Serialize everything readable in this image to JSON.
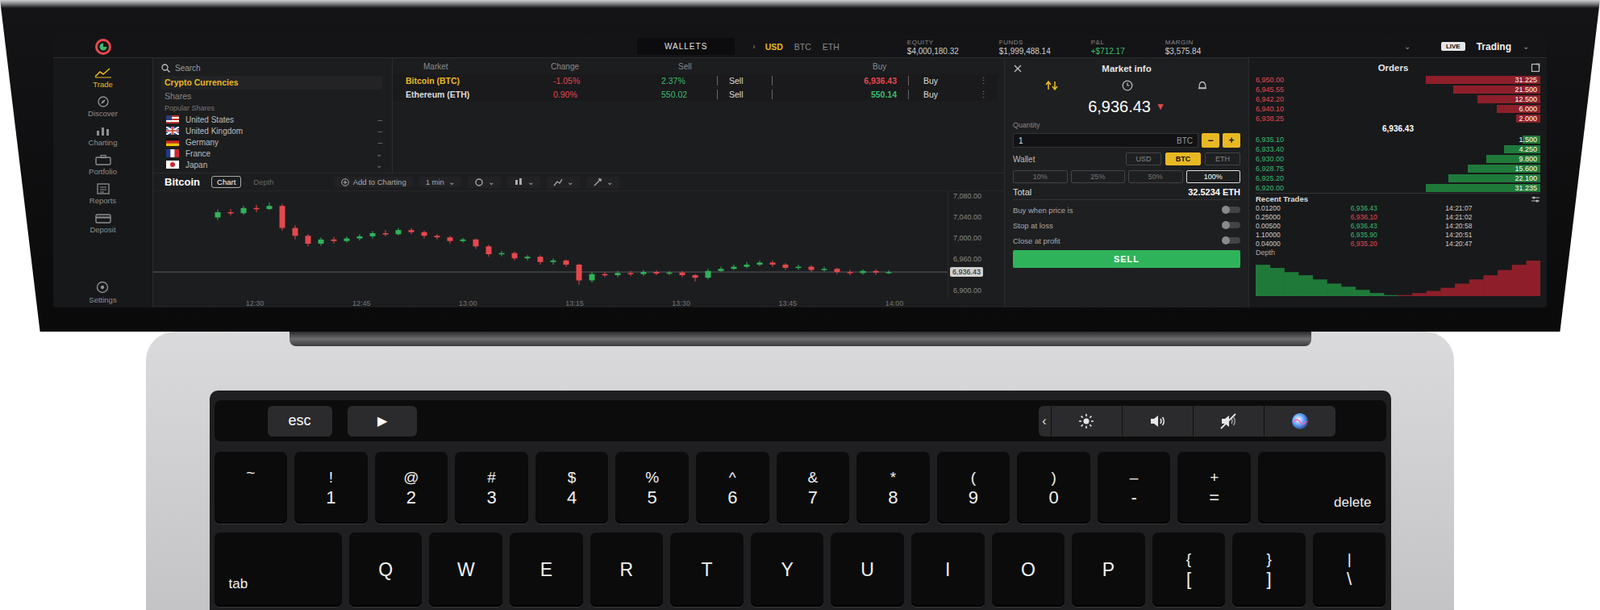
{
  "top_bar": {
    "wallets": "WALLETS",
    "separator": "›",
    "currencies": [
      {
        "label": "USD",
        "selected": true
      },
      {
        "label": "BTC",
        "selected": false
      },
      {
        "label": "ETH",
        "selected": false
      }
    ],
    "stats": [
      {
        "label": "EQUITY",
        "value": "$4,000,180.32",
        "color": "#cfcfcf"
      },
      {
        "label": "FUNDS",
        "value": "$1,999,488.14",
        "color": "#cfcfcf"
      },
      {
        "label": "P&L",
        "value": "+$712.17",
        "color": "#3dbb6b"
      },
      {
        "label": "MARGIN",
        "value": "$3,575.84",
        "color": "#cfcfcf"
      }
    ],
    "stats_caret": "⌄",
    "mode_badge": "LIVE",
    "mode": "Trading",
    "mode_caret": "⌄"
  },
  "sidebar": {
    "items": [
      {
        "label": "Trade",
        "selected": true
      },
      {
        "label": "Discover",
        "selected": false
      },
      {
        "label": "Charting",
        "selected": false
      },
      {
        "label": "Portfolio",
        "selected": false
      },
      {
        "label": "Reports",
        "selected": false
      },
      {
        "label": "Deposit",
        "selected": false
      }
    ],
    "footer": "Settings"
  },
  "markets": {
    "search": {
      "placeholder": "Search"
    },
    "columns": [
      "Market",
      "Change",
      "Sell",
      "Buy"
    ],
    "categories": [
      {
        "label": "Crypto Currencies",
        "selected": true
      },
      {
        "label": "Shares",
        "selected": false
      }
    ],
    "group": "Popular Shares",
    "countries": [
      {
        "name": "United States",
        "mark": "–"
      },
      {
        "name": "United Kingdom",
        "mark": "–"
      },
      {
        "name": "Germany",
        "mark": "–"
      },
      {
        "name": "France",
        "mark": "⌄"
      },
      {
        "name": "Japan",
        "mark": "⌄"
      }
    ],
    "rows": [
      {
        "name": "Bitcoin (BTC)",
        "selected": true,
        "change": "-1.05%",
        "change_color": "#e5484d",
        "spread": "2.37%",
        "spread_color": "#3dbb6b",
        "sell": "Sell",
        "price": "6,936.43",
        "price_color": "#e5484d",
        "buy": "Buy",
        "more": "⋮"
      },
      {
        "name": "Ethereum (ETH)",
        "selected": false,
        "change": "0.90%",
        "change_color": "#e5484d",
        "spread": "550.02",
        "spread_color": "#3dbb6b",
        "sell": "Sell",
        "price": "550.14",
        "price_color": "#3dbb6b",
        "buy": "Buy",
        "more": "⋮"
      }
    ]
  },
  "chart": {
    "title": "Bitcoin",
    "views": [
      {
        "label": "Chart",
        "selected": true
      },
      {
        "label": "Depth",
        "selected": false
      }
    ],
    "add": "Add to Charting",
    "interval": "1 min",
    "caret": "⌄",
    "y_ticks": [
      {
        "label": "7,080.00",
        "value": 7080
      },
      {
        "label": "7,040.00",
        "value": 7040
      },
      {
        "label": "7,000.00",
        "value": 7000
      },
      {
        "label": "6,960.00",
        "value": 6960
      },
      {
        "label": "6,900.00",
        "value": 6900
      }
    ],
    "x_ticks": [
      "12:30",
      "12:45",
      "13:00",
      "13:15",
      "13:30",
      "13:45",
      "14:00"
    ],
    "last": "6,936.43",
    "candles": [
      [
        7040,
        7050,
        7055,
        7035
      ],
      [
        7050,
        7048,
        7056,
        7044
      ],
      [
        7048,
        7058,
        7062,
        7045
      ],
      [
        7058,
        7056,
        7064,
        7050
      ],
      [
        7056,
        7062,
        7068,
        7054
      ],
      [
        7062,
        7020,
        7066,
        7015
      ],
      [
        7020,
        7005,
        7025,
        6998
      ],
      [
        7005,
        6990,
        7008,
        6985
      ],
      [
        6990,
        6998,
        7002,
        6986
      ],
      [
        6998,
        6995,
        7003,
        6990
      ],
      [
        6995,
        7000,
        7004,
        6992
      ],
      [
        7000,
        7004,
        7008,
        6996
      ],
      [
        7004,
        7010,
        7014,
        7000
      ],
      [
        7010,
        7008,
        7016,
        7004
      ],
      [
        7008,
        7016,
        7020,
        7006
      ],
      [
        7016,
        7012,
        7020,
        7008
      ],
      [
        7012,
        7005,
        7015,
        7000
      ],
      [
        7005,
        7002,
        7008,
        6998
      ],
      [
        7002,
        6995,
        7005,
        6990
      ],
      [
        6995,
        6998,
        7001,
        6992
      ],
      [
        6998,
        6985,
        7000,
        6980
      ],
      [
        6985,
        6970,
        6988,
        6965
      ],
      [
        6970,
        6972,
        6976,
        6966
      ],
      [
        6972,
        6962,
        6975,
        6958
      ],
      [
        6962,
        6965,
        6968,
        6958
      ],
      [
        6965,
        6955,
        6968,
        6950
      ],
      [
        6955,
        6958,
        6962,
        6950
      ],
      [
        6958,
        6950,
        6960,
        6946
      ],
      [
        6950,
        6920,
        6952,
        6912
      ],
      [
        6920,
        6932,
        6936,
        6916
      ],
      [
        6932,
        6930,
        6936,
        6926
      ],
      [
        6930,
        6934,
        6938,
        6926
      ],
      [
        6934,
        6932,
        6938,
        6928
      ],
      [
        6932,
        6936,
        6940,
        6928
      ],
      [
        6936,
        6933,
        6939,
        6930
      ],
      [
        6933,
        6935,
        6938,
        6930
      ],
      [
        6935,
        6930,
        6938,
        6926
      ],
      [
        6930,
        6925,
        6932,
        6918
      ],
      [
        6925,
        6938,
        6942,
        6922
      ],
      [
        6938,
        6942,
        6946,
        6936
      ],
      [
        6942,
        6946,
        6950,
        6940
      ],
      [
        6946,
        6950,
        6955,
        6943
      ],
      [
        6950,
        6954,
        6958,
        6947
      ],
      [
        6954,
        6950,
        6958,
        6946
      ],
      [
        6950,
        6944,
        6953,
        6940
      ],
      [
        6944,
        6946,
        6950,
        6940
      ],
      [
        6946,
        6940,
        6949,
        6936
      ],
      [
        6940,
        6942,
        6946,
        6937
      ],
      [
        6942,
        6936,
        6944,
        6932
      ],
      [
        6936,
        6934,
        6940,
        6930
      ],
      [
        6934,
        6938,
        6941,
        6931
      ],
      [
        6938,
        6935,
        6941,
        6931
      ],
      [
        6935,
        6936,
        6939,
        6932
      ]
    ]
  },
  "market_info": {
    "title": "Market info",
    "price": "6,936.43",
    "price_arrow": "▼",
    "quantity_label": "Quantity",
    "quantity": "1",
    "unit": "BTC",
    "minus": "−",
    "plus": "+",
    "wallet_label": "Wallet",
    "wallets": [
      {
        "label": "USD",
        "selected": false
      },
      {
        "label": "BTC",
        "selected": true
      },
      {
        "label": "ETH",
        "selected": false
      }
    ],
    "percents": [
      {
        "label": "10%",
        "selected": false
      },
      {
        "label": "25%",
        "selected": false
      },
      {
        "label": "50%",
        "selected": false
      },
      {
        "label": "100%",
        "selected": true
      }
    ],
    "total_label": "Total",
    "total": "32.5234 ETH",
    "options": [
      {
        "label": "Buy when price is",
        "on": false
      },
      {
        "label": "Stop at loss",
        "on": false
      },
      {
        "label": "Close at profit",
        "on": false
      }
    ],
    "action": "SELL"
  },
  "orders": {
    "title": "Orders",
    "asks": [
      {
        "price": "6,950.00",
        "amount": "31.225",
        "level": 0.95
      },
      {
        "price": "6,945.55",
        "amount": "21.500",
        "level": 0.72
      },
      {
        "price": "6,942.20",
        "amount": "12.500",
        "level": 0.52
      },
      {
        "price": "6,940.10",
        "amount": "6.000",
        "level": 0.36
      },
      {
        "price": "6,938.25",
        "amount": "2.000",
        "level": 0.2
      }
    ],
    "mid": "6,936.43",
    "bids": [
      {
        "price": "6,935.10",
        "amount": "1.500",
        "level": 0.15
      },
      {
        "price": "6,933.40",
        "amount": "4.250",
        "level": 0.3
      },
      {
        "price": "6,930.00",
        "amount": "9.800",
        "level": 0.45
      },
      {
        "price": "6,928.75",
        "amount": "15.600",
        "level": 0.6
      },
      {
        "price": "6,925.20",
        "amount": "22.100",
        "level": 0.76
      },
      {
        "price": "6,920.00",
        "amount": "31.235",
        "level": 0.95
      }
    ],
    "recent_title": "Recent Trades",
    "trades": [
      {
        "amount": "0.01200",
        "price": "6,936.43",
        "time": "14:21:07",
        "color": "#3dbb6b"
      },
      {
        "amount": "0.25000",
        "price": "6,936.10",
        "time": "14:21:02",
        "color": "#e5484d"
      },
      {
        "amount": "0.00500",
        "price": "6,936.43",
        "time": "14:20:58",
        "color": "#3dbb6b"
      },
      {
        "amount": "1.10000",
        "price": "6,935.90",
        "time": "14:20:51",
        "color": "#3dbb6b"
      },
      {
        "amount": "0.04000",
        "price": "6,935.20",
        "time": "14:20:47",
        "color": "#e5484d"
      }
    ],
    "depth_title": "Depth",
    "bid_depth": [
      30,
      27,
      23,
      20,
      16,
      12,
      9,
      6,
      3,
      1
    ],
    "ask_depth": [
      1,
      3,
      5,
      8,
      12,
      16,
      20,
      25,
      30,
      34
    ]
  },
  "keyboard": {
    "touch_bar": {
      "esc": "esc",
      "play": "▶",
      "expand": "‹"
    },
    "rows": [
      [
        {
          "kind": "symbol",
          "top": "~"
        },
        {
          "kind": "dual",
          "top": "!",
          "bottom": "1"
        },
        {
          "kind": "dual",
          "top": "@",
          "bottom": "2"
        },
        {
          "kind": "dual",
          "top": "#",
          "bottom": "3"
        },
        {
          "kind": "dual",
          "top": "$",
          "bottom": "4"
        },
        {
          "kind": "dual",
          "top": "%",
          "bottom": "5"
        },
        {
          "kind": "dual",
          "top": "^",
          "bottom": "6"
        },
        {
          "kind": "dual",
          "top": "&",
          "bottom": "7"
        },
        {
          "kind": "dual",
          "top": "*",
          "bottom": "8"
        },
        {
          "kind": "dual",
          "top": "(",
          "bottom": "9"
        },
        {
          "kind": "dual",
          "top": ")",
          "bottom": "0"
        },
        {
          "kind": "dual",
          "top": "–",
          "bottom": "-"
        },
        {
          "kind": "dual",
          "top": "+",
          "bottom": "="
        },
        {
          "kind": "modright",
          "label": "delete"
        }
      ],
      [
        {
          "kind": "modleft",
          "label": "tab"
        },
        {
          "kind": "letter",
          "label": "Q"
        },
        {
          "kind": "letter",
          "label": "W"
        },
        {
          "kind": "letter",
          "label": "E"
        },
        {
          "kind": "letter",
          "label": "R"
        },
        {
          "kind": "letter",
          "label": "T"
        },
        {
          "kind": "letter",
          "label": "Y"
        },
        {
          "kind": "letter",
          "label": "U"
        },
        {
          "kind": "letter",
          "label": "I"
        },
        {
          "kind": "letter",
          "label": "O"
        },
        {
          "kind": "letter",
          "label": "P"
        },
        {
          "kind": "dual",
          "top": "{",
          "bottom": "["
        },
        {
          "kind": "dual",
          "top": "}",
          "bottom": "]"
        },
        {
          "kind": "dual",
          "top": "|",
          "bottom": "\\"
        }
      ]
    ]
  }
}
